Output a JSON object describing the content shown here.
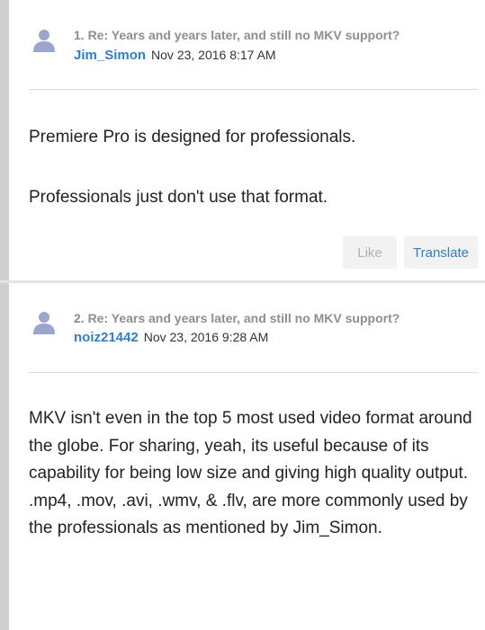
{
  "posts": [
    {
      "subject": "1. Re: Years and years later, and still no MKV support?",
      "author": "Jim_Simon",
      "date": "Nov 23, 2016 8:17 AM",
      "paragraphs": [
        "Premiere Pro is designed for professionals.",
        "Professionals just don't use that format."
      ],
      "actions": {
        "like_label": "Like",
        "translate_label": "Translate"
      }
    },
    {
      "subject": "2. Re: Years and years later, and still no MKV support?",
      "author": "noiz21442",
      "date": "Nov 23, 2016 9:28 AM",
      "paragraphs": [
        "MKV isn't even in the top 5 most used video format around the globe. For sharing, yeah, its useful because of its capability for being low size and giving high quality output.",
        ".mp4, .mov, .avi, .wmv, & .flv, are more commonly used by the professionals as mentioned by Jim_Simon."
      ]
    }
  ],
  "colors": {
    "author_link": "#2f7fcc",
    "subject_gray": "#8e8e8e",
    "avatar": "#9aa6cf",
    "left_rail": "#cfcfcf"
  },
  "icons": {
    "avatar": "user-avatar-icon"
  }
}
